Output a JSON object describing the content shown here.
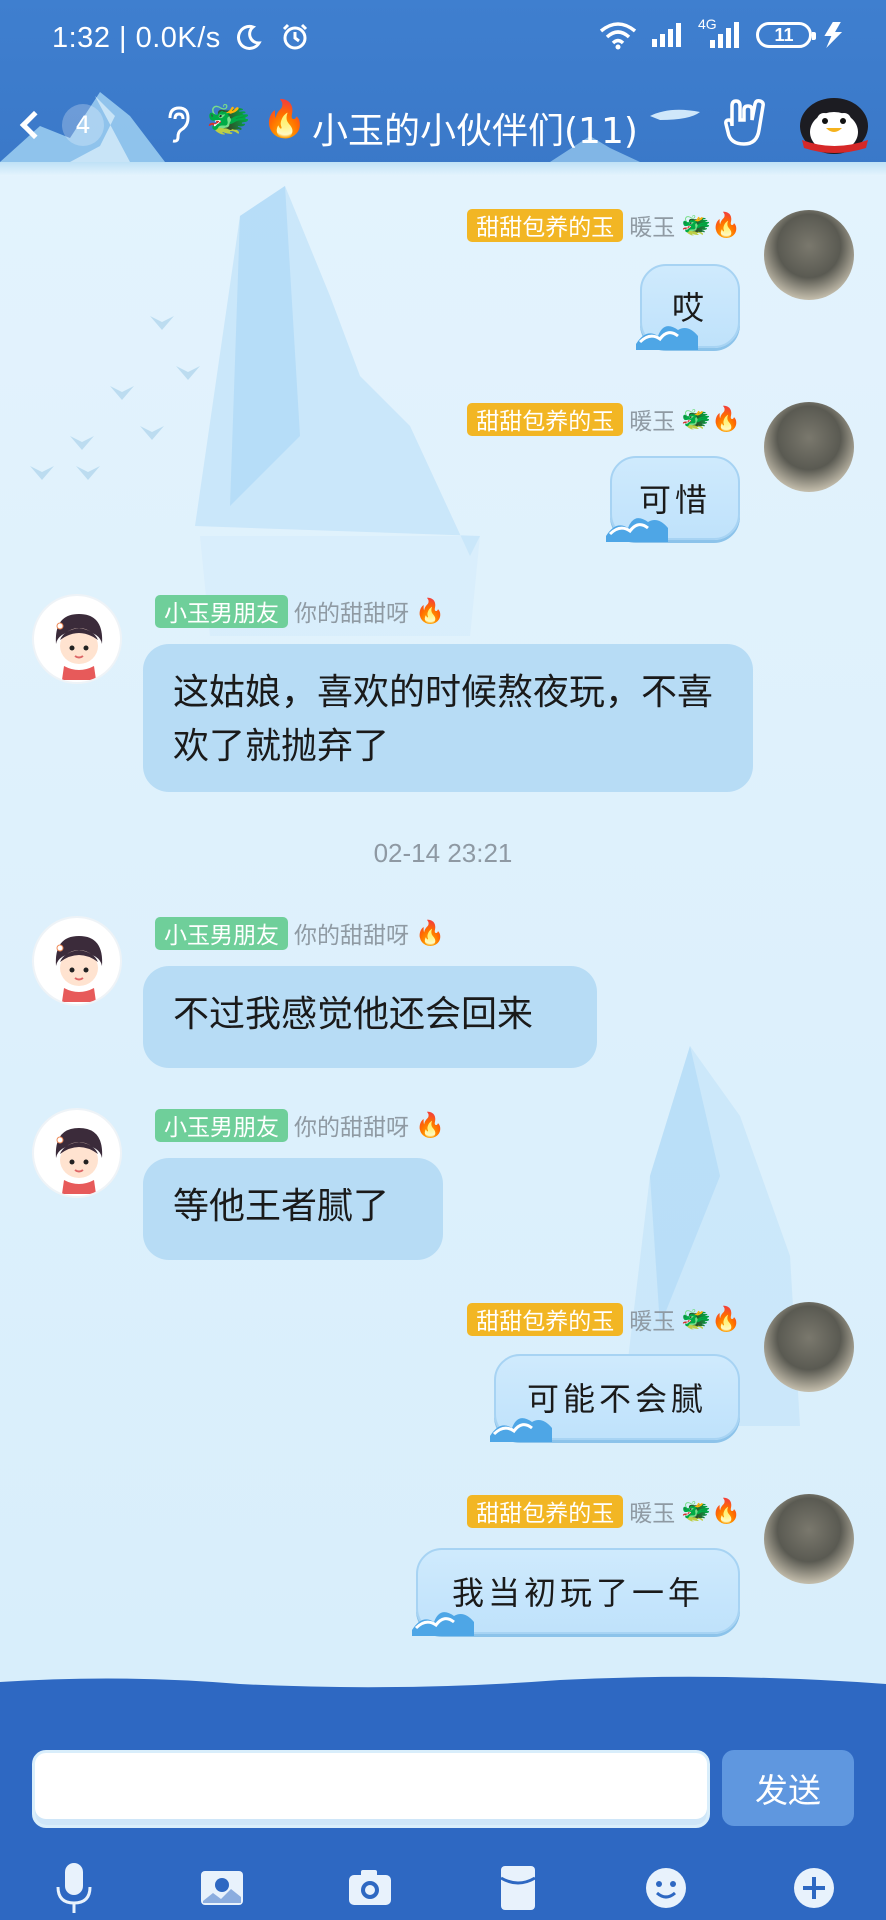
{
  "status": {
    "time": "1:32 | 0.0K/s",
    "network": "4G",
    "battery": "11"
  },
  "header": {
    "back_count": "4",
    "title": "小玉的小伙伴们(11)",
    "title_emoji_dragon": "🐲",
    "title_emoji_fire": "🔥"
  },
  "messages": [
    {
      "sender": "me",
      "tag": "甜甜包养的玉",
      "nick": "暖玉",
      "emojis": "🐲🔥",
      "text": "哎"
    },
    {
      "sender": "me",
      "tag": "甜甜包养的玉",
      "nick": "暖玉",
      "emojis": "🐲🔥",
      "text": "可惜"
    },
    {
      "sender": "friend",
      "tag": "小玉男朋友",
      "nick": "你的甜甜呀",
      "emojis": "🔥",
      "text": "这姑娘，喜欢的时候熬夜玩，不喜欢了就抛弃了"
    },
    {
      "sender": "friend",
      "tag": "小玉男朋友",
      "nick": "你的甜甜呀",
      "emojis": "🔥",
      "text": "不过我感觉他还会回来"
    },
    {
      "sender": "friend",
      "tag": "小玉男朋友",
      "nick": "你的甜甜呀",
      "emojis": "🔥",
      "text": "等他王者腻了"
    },
    {
      "sender": "me",
      "tag": "甜甜包养的玉",
      "nick": "暖玉",
      "emojis": "🐲🔥",
      "text": "可能不会腻"
    },
    {
      "sender": "me",
      "tag": "甜甜包养的玉",
      "nick": "暖玉",
      "emojis": "🐲🔥",
      "text": "我当初玩了一年"
    }
  ],
  "timestamp": "02-14 23:21",
  "input": {
    "value": "",
    "send_label": "发送"
  },
  "toolbar": [
    "microphone-icon",
    "photo-icon",
    "camera-icon",
    "red-packet-icon",
    "emoji-icon",
    "plus-icon"
  ],
  "colors": {
    "header_blue": "#3a78c8",
    "chat_bg": "#dbeefa",
    "tag_gold": "#f2b624",
    "tag_green": "#6fcf9a",
    "friend_bubble": "#b7dcf5",
    "send_button": "#5f97df"
  }
}
